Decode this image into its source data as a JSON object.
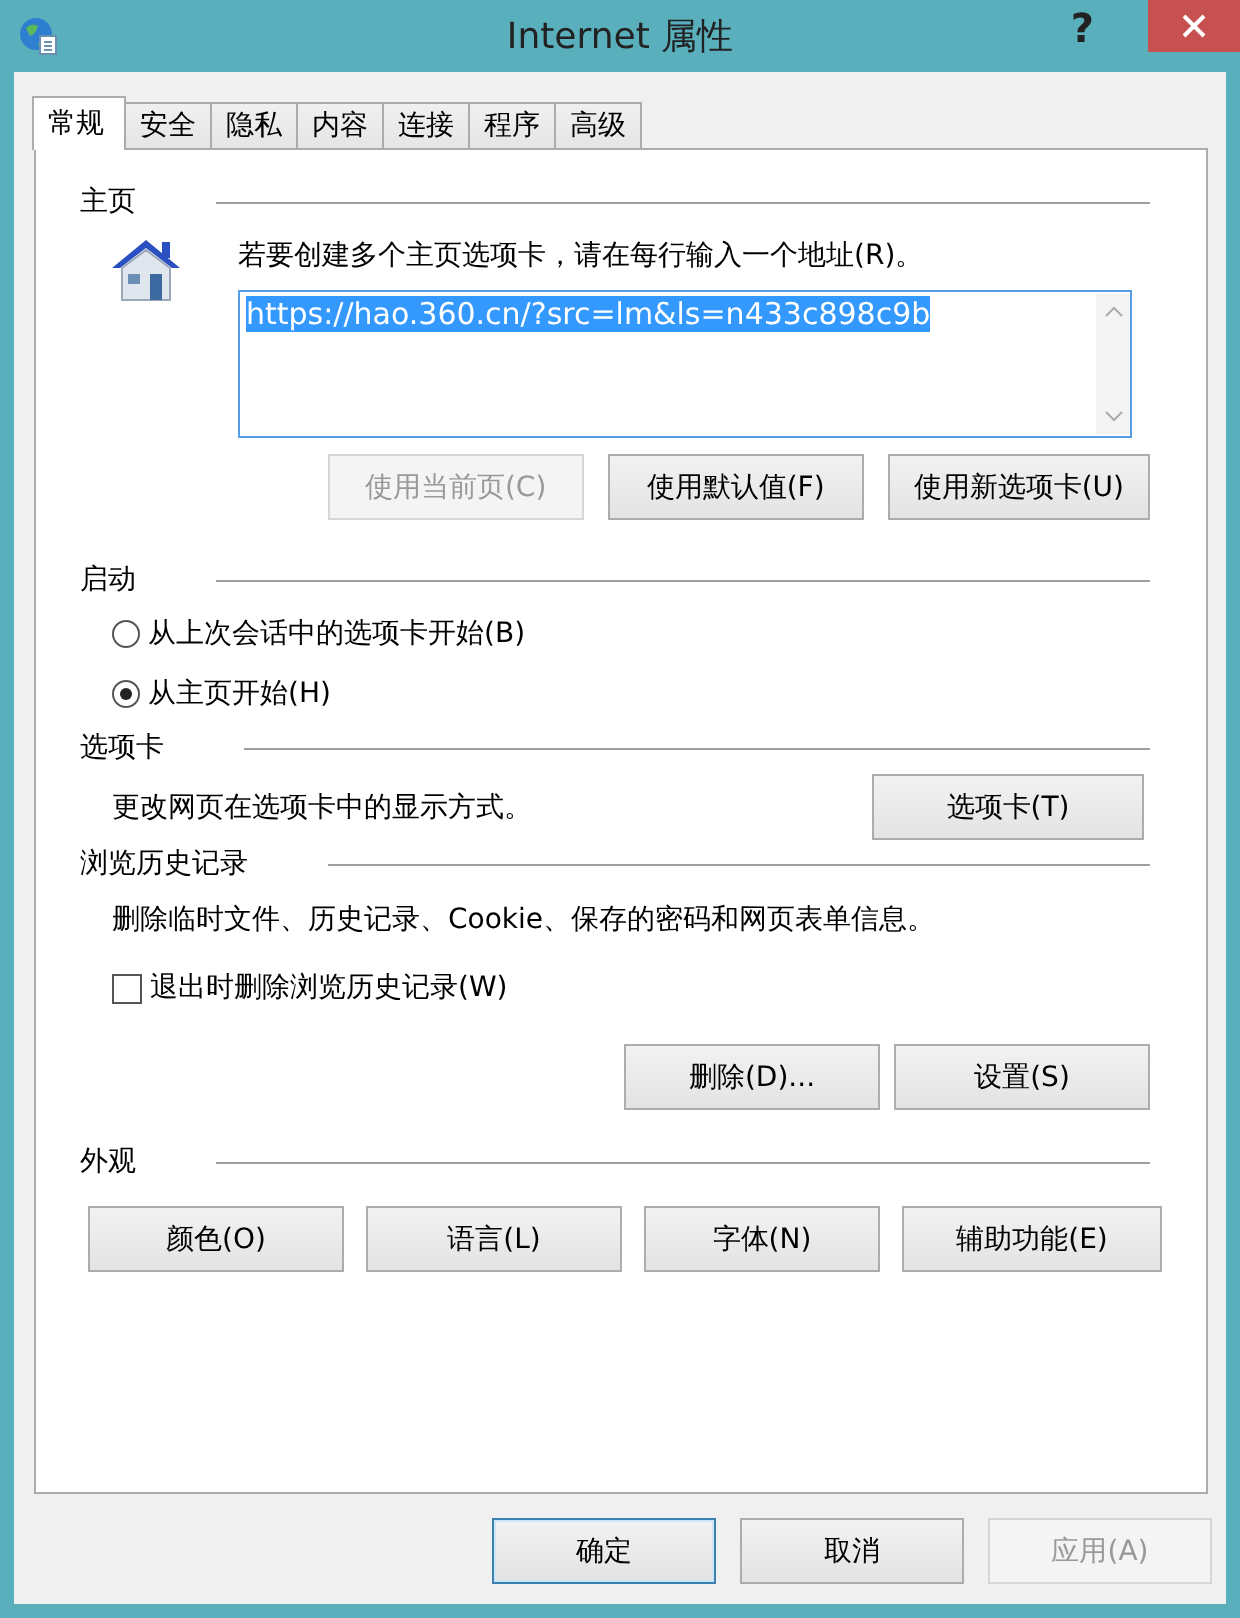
{
  "window": {
    "title": "Internet 属性",
    "help": "?"
  },
  "tabs": [
    {
      "label": "常规",
      "selected": true
    },
    {
      "label": "安全",
      "selected": false
    },
    {
      "label": "隐私",
      "selected": false
    },
    {
      "label": "内容",
      "selected": false
    },
    {
      "label": "连接",
      "selected": false
    },
    {
      "label": "程序",
      "selected": false
    },
    {
      "label": "高级",
      "selected": false
    }
  ],
  "home_page": {
    "title": "主页",
    "prompt": "若要创建多个主页选项卡，请在每行输入一个地址(R)。",
    "url": "https://hao.360.cn/?src=lm&ls=n433c898c9b",
    "buttons": [
      {
        "label": "使用当前页(C)",
        "disabled": true
      },
      {
        "label": "使用默认值(F)",
        "disabled": false
      },
      {
        "label": "使用新选项卡(U)",
        "disabled": false
      }
    ]
  },
  "startup": {
    "title": "启动",
    "options": [
      {
        "label": "从上次会话中的选项卡开始(B)",
        "selected": false
      },
      {
        "label": "从主页开始(H)",
        "selected": true
      }
    ]
  },
  "tab_settings": {
    "title": "选项卡",
    "description": "更改网页在选项卡中的显示方式。",
    "button": {
      "label": "选项卡(T)",
      "disabled": false
    }
  },
  "history": {
    "title": "浏览历史记录",
    "description": "删除临时文件、历史记录、Cookie、保存的密码和网页表单信息。",
    "checkbox": {
      "label": "退出时删除浏览历史记录(W)",
      "checked": false
    },
    "buttons": [
      {
        "label": "删除(D)...",
        "disabled": false
      },
      {
        "label": "设置(S)",
        "disabled": false
      }
    ]
  },
  "appearance": {
    "title": "外观",
    "buttons": [
      {
        "label": "颜色(O)",
        "disabled": false
      },
      {
        "label": "语言(L)",
        "disabled": false
      },
      {
        "label": "字体(N)",
        "disabled": false
      },
      {
        "label": "辅助功能(E)",
        "disabled": false
      }
    ]
  },
  "footer": {
    "buttons": [
      {
        "label": "确定",
        "default": true,
        "disabled": false
      },
      {
        "label": "取消",
        "default": false,
        "disabled": false
      },
      {
        "label": "应用(A)",
        "default": false,
        "disabled": true
      }
    ]
  }
}
